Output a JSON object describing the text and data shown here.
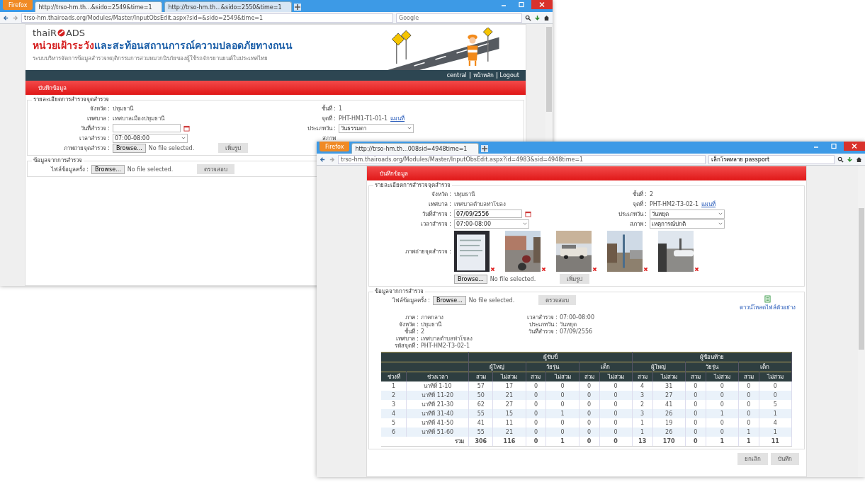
{
  "back_window": {
    "browser": {
      "menu_button": "Firefox",
      "tabs": [
        {
          "label": "http://trso-hm.th...&sido=2549&time=1",
          "selected": true
        },
        {
          "label": "http://trso-hm.th...&sido=2550&time=1",
          "selected": false
        }
      ],
      "url": "trso-hm.thairoads.org/Modules/Master/InputObsEdit.aspx?sid=&sido=2549&time=1",
      "search": {
        "placeholder": "Google"
      }
    },
    "logo": {
      "before": "thaiR",
      "after": "ADS"
    },
    "heading": {
      "highlight": "หน่วยเฝ้าระวัง",
      "rest": "และสะท้อนสถานการณ์ความปลอดภัยทางถนน"
    },
    "subtitle": "ระบบบริหารจัดการข้อมูลสำรวจพฤติกรรมการสวมหมวกนิรภัยของผู้ใช้รถจักรยานยนต์ในประเทศไทย",
    "nav_links": [
      "central",
      "หน้าหลัก",
      "Logout"
    ],
    "page_title": "บันทึกข้อมูล",
    "survey_point": {
      "legend": "รายละเอียดการสำรวจจุดสำรวจ",
      "left": [
        {
          "kind": "text",
          "label": "จังหวัด :",
          "value": "ปทุมธานี"
        },
        {
          "kind": "text",
          "label": "เทศบาล :",
          "value": "เทศบาลเมืองปทุมธานี"
        },
        {
          "kind": "date",
          "label": "วันที่สำรวจ :"
        },
        {
          "kind": "select",
          "label": "เวลาสำรวจ :",
          "value": "07:00-08:00"
        },
        {
          "kind": "file",
          "label": "ภาพถ่ายจุดสำรวจ :",
          "browse": "Browse...",
          "status": "No file selected.",
          "button": "เพิ่มรูป"
        }
      ],
      "right": [
        {
          "kind": "text",
          "label": "ชั้นที่ :",
          "value": "1"
        },
        {
          "kind": "link",
          "label": "จุดที่ :",
          "value": "PHT-HM1-T1-01-1",
          "link": "แผนที่"
        },
        {
          "kind": "select",
          "label": "ประเภทวัน :",
          "value": "วันธรรมดา"
        },
        {
          "kind": "cut",
          "label": "สภาพ"
        }
      ]
    },
    "survey_data": {
      "legend": "ข้อมูลจากการสำรวจ",
      "label": "ไฟล์ข้อมูลครั้ง :",
      "browse": "Browse...",
      "status": "No file selected.",
      "button": "ตรวจสอบ"
    }
  },
  "front_window": {
    "browser": {
      "menu_button": "Firefox",
      "tabs": [
        {
          "label": "http://trso-hm.th...008sid=4948time=1",
          "selected": true
        }
      ],
      "url": "trso-hm.thairoads.org/Modules/Master/InputObsEdit.aspx?id=4983&sid=4948time=1",
      "search": {
        "value": "เล็กโรคหลาย passport"
      }
    },
    "page_title": "บันทึกข้อมูล",
    "survey_point": {
      "legend": "รายละเอียดการสำรวจจุดสำรวจ",
      "left": [
        {
          "kind": "text",
          "label": "จังหวัด :",
          "value": "ปทุมธานี"
        },
        {
          "kind": "text",
          "label": "เทศบาล :",
          "value": "เทศบาลตำบลท่าโขลง"
        },
        {
          "kind": "date",
          "label": "วันที่สำรวจ :",
          "value": "07/09/2556"
        },
        {
          "kind": "select",
          "label": "เวลาสำรวจ :",
          "value": "07:00-08:00"
        }
      ],
      "right": [
        {
          "kind": "text",
          "label": "ชั้นที่ :",
          "value": "2"
        },
        {
          "kind": "link",
          "label": "จุดที่ :",
          "value": "PHT-HM2-T3-02-1",
          "link": "แผนที่"
        },
        {
          "kind": "select",
          "label": "ประเภทวัน :",
          "value": "วันหยุด"
        },
        {
          "kind": "select",
          "label": "สภาพ :",
          "value": "เหตุการณ์ปกติ"
        }
      ],
      "photos_label": "ภาพถ่ายจุดสำรวจ :",
      "photos": [
        {
          "kind": "document"
        },
        {
          "kind": "street"
        },
        {
          "kind": "truck"
        },
        {
          "kind": "pole"
        },
        {
          "kind": "car"
        }
      ],
      "browse": "Browse...",
      "status": "No file selected.",
      "button": "เพิ่มรูป"
    },
    "survey_data": {
      "legend": "ข้อมูลจากการสำรวจ",
      "label": "ไฟล์ข้อมูลครั้ง :",
      "browse": "Browse...",
      "status": "No file selected.",
      "button": "ตรวจสอบ",
      "download": "ดาวน์โหลดไฟล์ตัวอย่าง",
      "info_left": [
        {
          "label": "ภาค :",
          "value": "ภาคกลาง"
        },
        {
          "label": "จังหวัด :",
          "value": "ปทุมธานี"
        },
        {
          "label": "ชั้นที่ :",
          "value": "2"
        },
        {
          "label": "เทศบาล :",
          "value": "เทศบาลตำบลท่าโขลง"
        },
        {
          "label": "รหัสจุดที่ :",
          "value": "PHT-HM2-T3-02-1"
        }
      ],
      "info_right": [
        {
          "label": "เวลาสำรวจ :",
          "value": "07:00-08:00"
        },
        {
          "label": "ประเภทวัน :",
          "value": "วันหยุด"
        },
        {
          "label": "วันที่สำรวจ :",
          "value": "07/09/2556"
        }
      ]
    },
    "table": {
      "groups": [
        "ผู้ขับขี่",
        "ผู้ซ้อนท้าย"
      ],
      "ages": [
        "ผู้ใหญ่",
        "วัยรุ่น",
        "เด็ก",
        "ผู้ใหญ่",
        "วัยรุ่น",
        "เด็ก"
      ],
      "columns": [
        "ช่วงที่",
        "ช่วงเวลา",
        "สวม",
        "ไม่สวม",
        "สวม",
        "ไม่สวม",
        "สวม",
        "ไม่สวม",
        "สวม",
        "ไม่สวม",
        "สวม",
        "ไม่สวม",
        "สวม",
        "ไม่สวม"
      ],
      "rows": [
        [
          "1",
          "นาทีที่ 1-10",
          "57",
          "17",
          "0",
          "0",
          "0",
          "0",
          "4",
          "31",
          "0",
          "0",
          "0",
          "0"
        ],
        [
          "2",
          "นาทีที่ 11-20",
          "50",
          "21",
          "0",
          "0",
          "0",
          "0",
          "3",
          "27",
          "0",
          "0",
          "0",
          "0"
        ],
        [
          "3",
          "นาทีที่ 21-30",
          "62",
          "27",
          "0",
          "0",
          "0",
          "0",
          "2",
          "41",
          "0",
          "0",
          "0",
          "5"
        ],
        [
          "4",
          "นาทีที่ 31-40",
          "55",
          "15",
          "0",
          "1",
          "0",
          "0",
          "3",
          "26",
          "0",
          "1",
          "0",
          "1"
        ],
        [
          "5",
          "นาทีที่ 41-50",
          "41",
          "11",
          "0",
          "0",
          "0",
          "0",
          "1",
          "19",
          "0",
          "0",
          "0",
          "4"
        ],
        [
          "6",
          "นาทีที่ 51-60",
          "55",
          "21",
          "0",
          "0",
          "0",
          "0",
          "1",
          "26",
          "0",
          "0",
          "1",
          "1"
        ]
      ],
      "total_label": "รวม",
      "totals": [
        "306",
        "116",
        "0",
        "1",
        "0",
        "0",
        "13",
        "170",
        "0",
        "1",
        "1",
        "11"
      ]
    },
    "buttons": [
      "ยกเลิก",
      "บันทึก"
    ]
  }
}
